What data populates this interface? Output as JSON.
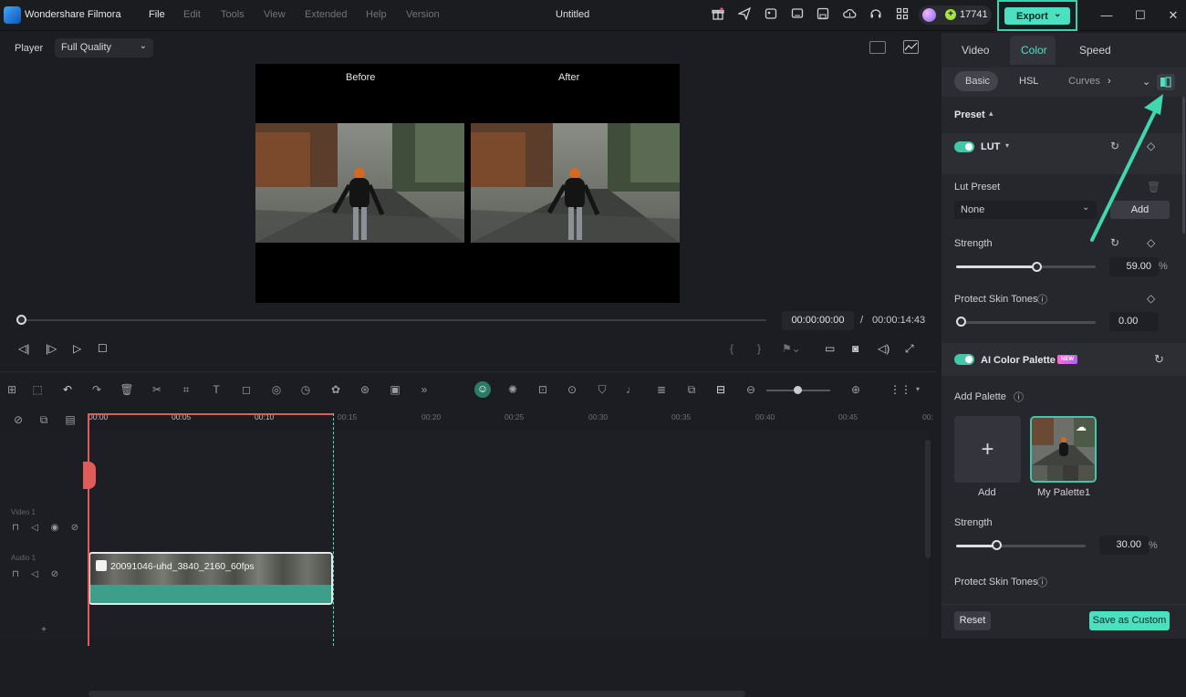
{
  "titlebar": {
    "app_name": "Wondershare Filmora",
    "menu": [
      "File",
      "Edit",
      "Tools",
      "View",
      "Extended",
      "Help",
      "Version"
    ],
    "document_title": "Untitled",
    "credits": "17741",
    "export_label": "Export"
  },
  "player": {
    "label": "Player",
    "quality": "Full Quality",
    "before_label": "Before",
    "after_label": "After",
    "time_current": "00:00:00:00",
    "time_separator": "/",
    "time_total": "00:00:14:43",
    "progress": 0
  },
  "timeline": {
    "ruler": [
      "00:00",
      "00:05",
      "00:10",
      "00:15",
      "00:20",
      "00:25",
      "00:30",
      "00:35",
      "00:40",
      "00:45",
      "00:"
    ],
    "tracks": [
      "Video 1",
      "Audio 1"
    ],
    "clip_name": "20091046-uhd_3840_2160_60fps"
  },
  "right_panel": {
    "tabs": [
      "Video",
      "Color",
      "Speed"
    ],
    "active_tab": "Color",
    "subtabs": [
      "Basic",
      "HSL",
      "Curves"
    ],
    "preset_label": "Preset",
    "lut_label": "LUT",
    "lut_preset_label": "Lut Preset",
    "lut_preset_value": "None",
    "add_label": "Add",
    "strength_label": "Strength",
    "strength_value": "59.00",
    "percent": "%",
    "protect_skin_label": "Protect Skin Tones",
    "protect_skin_value": "0.00",
    "ai_palette_label": "AI Color Palette",
    "new_badge": "NEW",
    "add_palette_label": "Add Palette",
    "tile_add_label": "Add",
    "tile_palette_label": "My Palette1",
    "palette_strength_label": "Strength",
    "palette_strength_value": "30.00",
    "palette_protect_label": "Protect Skin Tones",
    "reset_label": "Reset",
    "save_custom_label": "Save as Custom"
  },
  "colors": {
    "accent": "#4be0c0",
    "playhead": "#e25b5b",
    "annotation_arrow": "#3fd6b0"
  }
}
